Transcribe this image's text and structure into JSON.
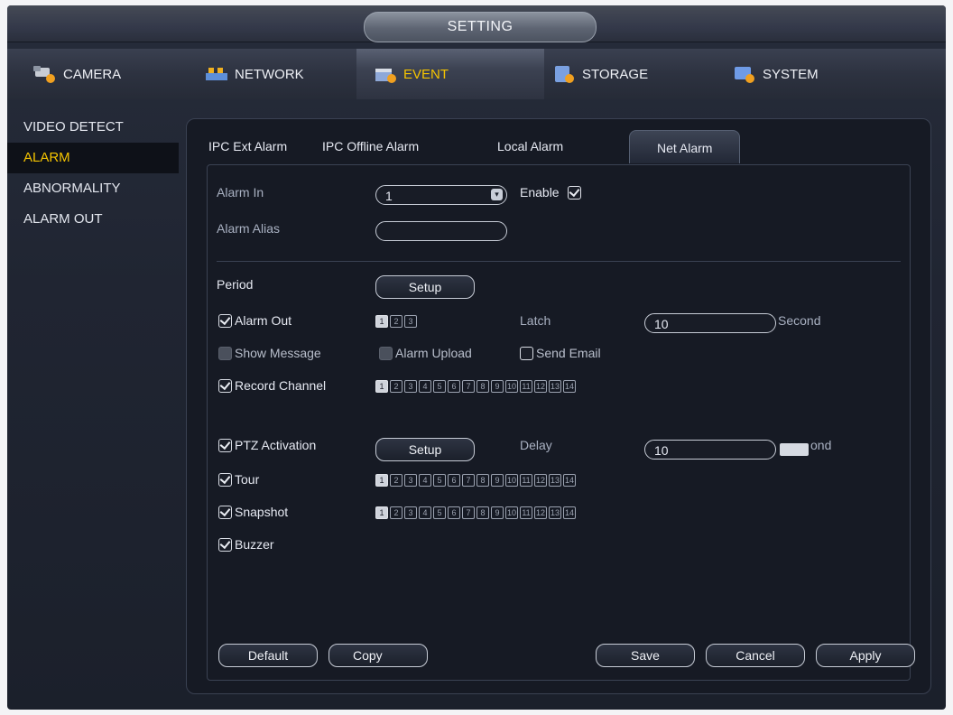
{
  "title": "SETTING",
  "main_tabs": [
    {
      "label": "CAMERA",
      "icon": "camera-icon"
    },
    {
      "label": "NETWORK",
      "icon": "network-icon"
    },
    {
      "label": "EVENT",
      "icon": "event-icon",
      "active": true
    },
    {
      "label": "STORAGE",
      "icon": "storage-icon"
    },
    {
      "label": "SYSTEM",
      "icon": "system-icon"
    }
  ],
  "left_nav": [
    {
      "label": "VIDEO DETECT"
    },
    {
      "label": "ALARM",
      "active": true
    },
    {
      "label": "ABNORMALITY"
    },
    {
      "label": "ALARM OUT"
    }
  ],
  "sub_tabs": [
    {
      "label": "IPC Ext Alarm"
    },
    {
      "label": "IPC Offline Alarm"
    },
    {
      "label": "Local Alarm"
    },
    {
      "label": "Net Alarm",
      "active": true
    }
  ],
  "form": {
    "alarm_in": {
      "label": "Alarm In",
      "value": "1"
    },
    "enable": {
      "label": "Enable",
      "checked": true
    },
    "alarm_alias": {
      "label": "Alarm Alias",
      "value": ""
    },
    "period": {
      "label": "Period",
      "button": "Setup"
    },
    "alarm_out": {
      "label": "Alarm Out",
      "checked": true,
      "channels": [
        "1",
        "2",
        "3"
      ],
      "selected": [
        "1"
      ]
    },
    "latch": {
      "label": "Latch",
      "value": "10",
      "unit": "Second"
    },
    "show_message": {
      "label": "Show Message",
      "checked": false,
      "disabled": true
    },
    "alarm_upload": {
      "label": "Alarm Upload",
      "checked": false,
      "disabled": true
    },
    "send_email": {
      "label": "Send Email",
      "checked": false
    },
    "record_channel": {
      "label": "Record Channel",
      "checked": true,
      "channels": [
        "1",
        "2",
        "3",
        "4",
        "5",
        "6",
        "7",
        "8",
        "9",
        "10",
        "11",
        "12",
        "13",
        "14"
      ],
      "selected": [
        "1"
      ]
    },
    "ptz_activation": {
      "label": "PTZ Activation",
      "checked": true,
      "button": "Setup"
    },
    "delay": {
      "label": "Delay",
      "value": "10",
      "unit_visible": "ond"
    },
    "tour": {
      "label": "Tour",
      "checked": true,
      "channels": [
        "1",
        "2",
        "3",
        "4",
        "5",
        "6",
        "7",
        "8",
        "9",
        "10",
        "11",
        "12",
        "13",
        "14"
      ],
      "selected": [
        "1"
      ]
    },
    "snapshot": {
      "label": "Snapshot",
      "checked": true,
      "channels": [
        "1",
        "2",
        "3",
        "4",
        "5",
        "6",
        "7",
        "8",
        "9",
        "10",
        "11",
        "12",
        "13",
        "14"
      ],
      "selected": [
        "1"
      ]
    },
    "buzzer": {
      "label": "Buzzer",
      "checked": true
    }
  },
  "buttons": {
    "default": "Default",
    "copy": "Copy",
    "save": "Save",
    "cancel": "Cancel",
    "apply": "Apply"
  },
  "colors": {
    "accent": "#f5c400",
    "background": "#1b202b",
    "panel": "#161a24"
  }
}
